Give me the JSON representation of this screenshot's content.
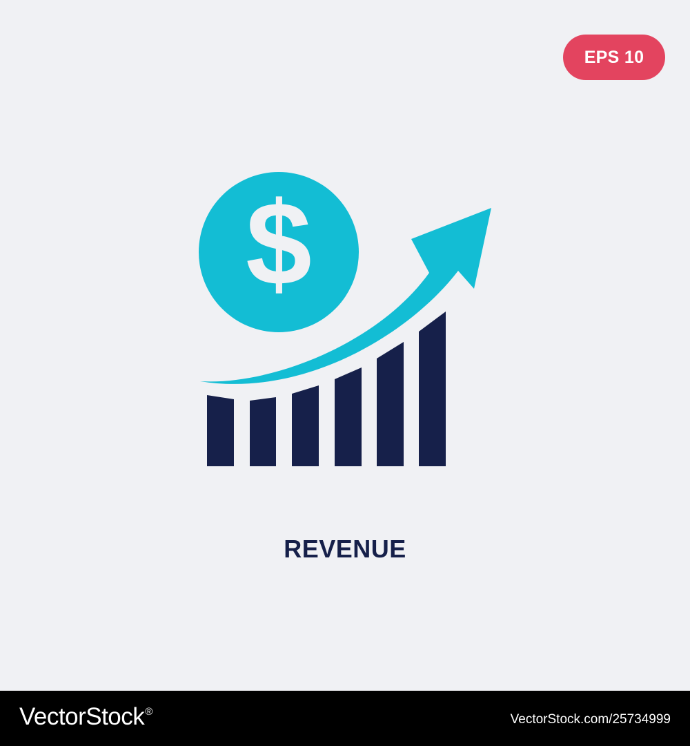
{
  "badge": {
    "label": "EPS 10"
  },
  "icon": {
    "name": "revenue-icon",
    "primary_color": "#16204a",
    "accent_color": "#13bdd4",
    "symbol": "$"
  },
  "caption": {
    "text": "REVENUE"
  },
  "footer": {
    "logo": "VectorStock",
    "registered_mark": "®",
    "url": "VectorStock.com/25734999"
  },
  "colors": {
    "background": "#f0f1f4",
    "badge": "#e3445f",
    "footer": "#000000"
  }
}
